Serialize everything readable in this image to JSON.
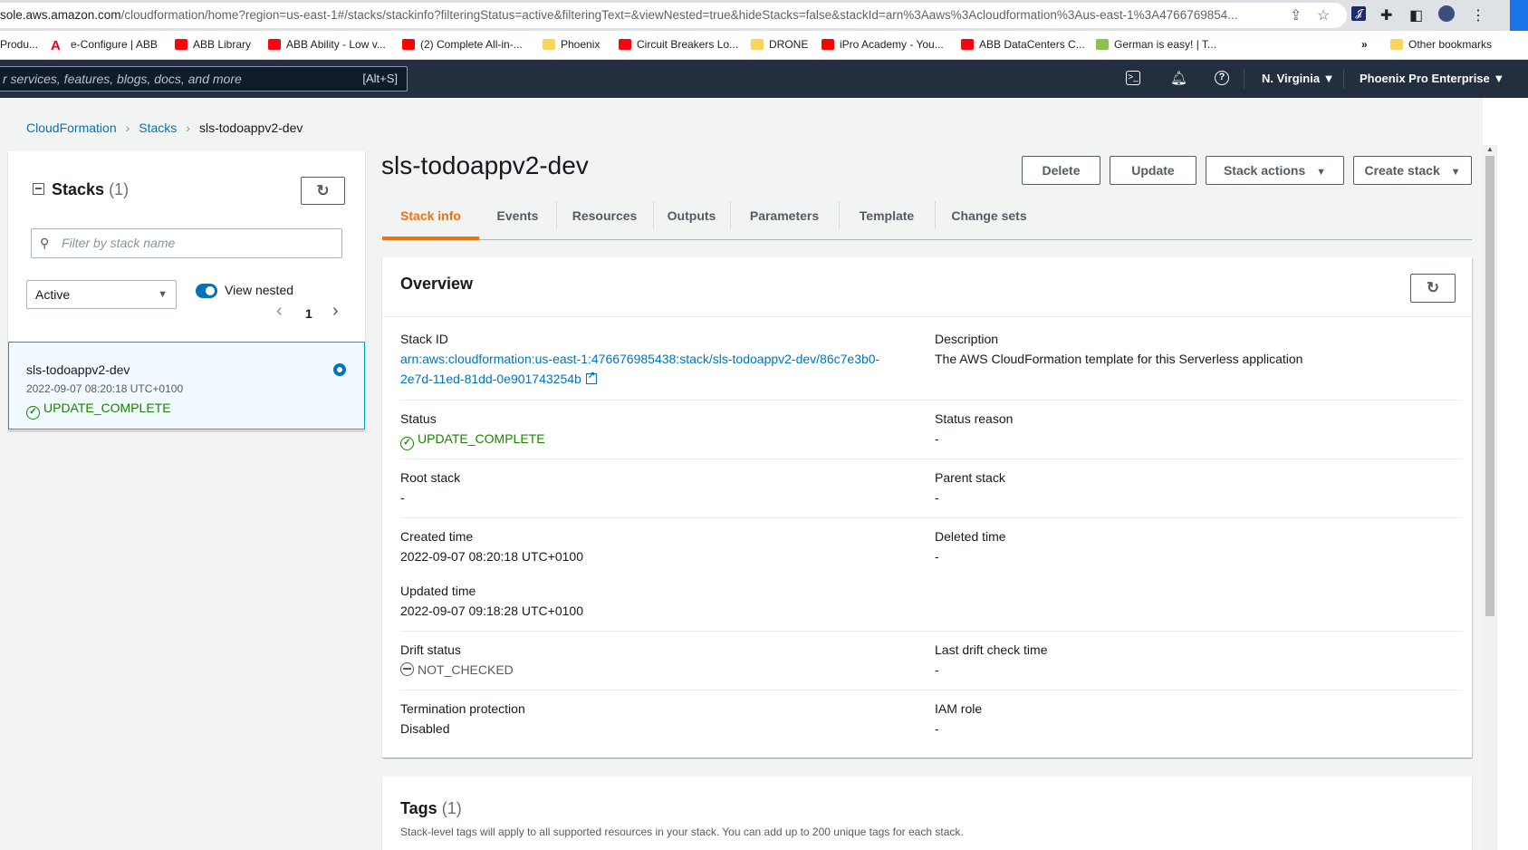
{
  "browser": {
    "url_host": "sole.aws.amazon.com",
    "url_path": "/cloudformation/home?region=us-east-1#/stacks/stackinfo?filteringStatus=active&filteringText=&viewNested=true&hideStacks=false&stackId=arn%3Aaws%3Acloudformation%3Aus-east-1%3A4766769854...",
    "bookmarks": [
      {
        "label": "Produ...",
        "icon_color": "#ffffff"
      },
      {
        "label": "e-Configure | ABB",
        "icon_color": "#e30613"
      },
      {
        "label": "ABB Library",
        "icon_color": "#ff000f"
      },
      {
        "label": "ABB Ability - Low v...",
        "icon_color": "#ff000f"
      },
      {
        "label": "(2) Complete All-in-...",
        "icon_color": "#ff0000"
      },
      {
        "label": "Phoenix",
        "icon_color": "#f9d55d"
      },
      {
        "label": "Circuit Breakers Lo...",
        "icon_color": "#ff000f"
      },
      {
        "label": "DRONE",
        "icon_color": "#f9d55d"
      },
      {
        "label": "iPro Academy - You...",
        "icon_color": "#ff0000"
      },
      {
        "label": "ABB DataCenters C...",
        "icon_color": "#ff000f"
      },
      {
        "label": "German is easy! | T...",
        "icon_color": "#8bc34a"
      }
    ],
    "more_label": "»",
    "other_bookmarks": "Other bookmarks"
  },
  "aws_nav": {
    "search_placeholder": "r services, features, blogs, docs, and more",
    "search_shortcut": "[Alt+S]",
    "region": "N. Virginia ▼",
    "account": "Phoenix Pro Enterprise ▼"
  },
  "breadcrumb": {
    "items": [
      "CloudFormation",
      "Stacks"
    ],
    "current": "sls-todoappv2-dev"
  },
  "left_panel": {
    "title": "Stacks",
    "count": "(1)",
    "filter_placeholder": "Filter by stack name",
    "status_filter": "Active",
    "view_nested_label": "View nested",
    "view_nested_on": true,
    "page": "1",
    "stacks": [
      {
        "name": "sls-todoappv2-dev",
        "time": "2022-09-07 08:20:18 UTC+0100",
        "status": "UPDATE_COMPLETE"
      }
    ]
  },
  "stack": {
    "title": "sls-todoappv2-dev",
    "buttons": {
      "delete": "Delete",
      "update": "Update",
      "stack_actions": "Stack actions",
      "create_stack": "Create stack"
    },
    "tabs": [
      "Stack info",
      "Events",
      "Resources",
      "Outputs",
      "Parameters",
      "Template",
      "Change sets"
    ],
    "active_tab": "Stack info"
  },
  "overview": {
    "title": "Overview",
    "stack_id_label": "Stack ID",
    "stack_id_line1": "arn:aws:cloudformation:us-east-1:476676985438:stack/sls-todoappv2-dev/86c7e3b0-",
    "stack_id_line2": "2e7d-11ed-81dd-0e901743254b",
    "description_label": "Description",
    "description": "The AWS CloudFormation template for this Serverless application",
    "status_label": "Status",
    "status": "UPDATE_COMPLETE",
    "status_reason_label": "Status reason",
    "status_reason": "-",
    "root_stack_label": "Root stack",
    "root_stack": "-",
    "parent_stack_label": "Parent stack",
    "parent_stack": "-",
    "created_label": "Created time",
    "created": "2022-09-07 08:20:18 UTC+0100",
    "deleted_label": "Deleted time",
    "deleted": "-",
    "updated_label": "Updated time",
    "updated": "2022-09-07 09:18:28 UTC+0100",
    "drift_label": "Drift status",
    "drift": "NOT_CHECKED",
    "last_drift_label": "Last drift check time",
    "last_drift": "-",
    "termination_label": "Termination protection",
    "termination": "Disabled",
    "iam_label": "IAM role",
    "iam": "-"
  },
  "tags": {
    "title": "Tags",
    "count": "(1)",
    "description": "Stack-level tags will apply to all supported resources in your stack. You can add up to 200 unique tags for each stack."
  }
}
